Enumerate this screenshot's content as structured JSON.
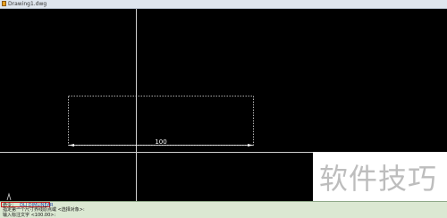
{
  "window": {
    "title": "Drawing1.dwg"
  },
  "canvas": {
    "background": "#000000",
    "crosshair_color": "#cfcfcf",
    "dimension": {
      "text": "100",
      "color": "#ffffff"
    }
  },
  "watermark": {
    "text": "软件技巧"
  },
  "command_line": {
    "line1_prefix": "命令：",
    "line1_command": "_DLI DIMLINEAR",
    "line2": "指定第一个尺寸界线原点或 <选择对象>:",
    "line3": "输入标注文字 <100.00>:",
    "highlight_color": "#cc1f1f"
  }
}
